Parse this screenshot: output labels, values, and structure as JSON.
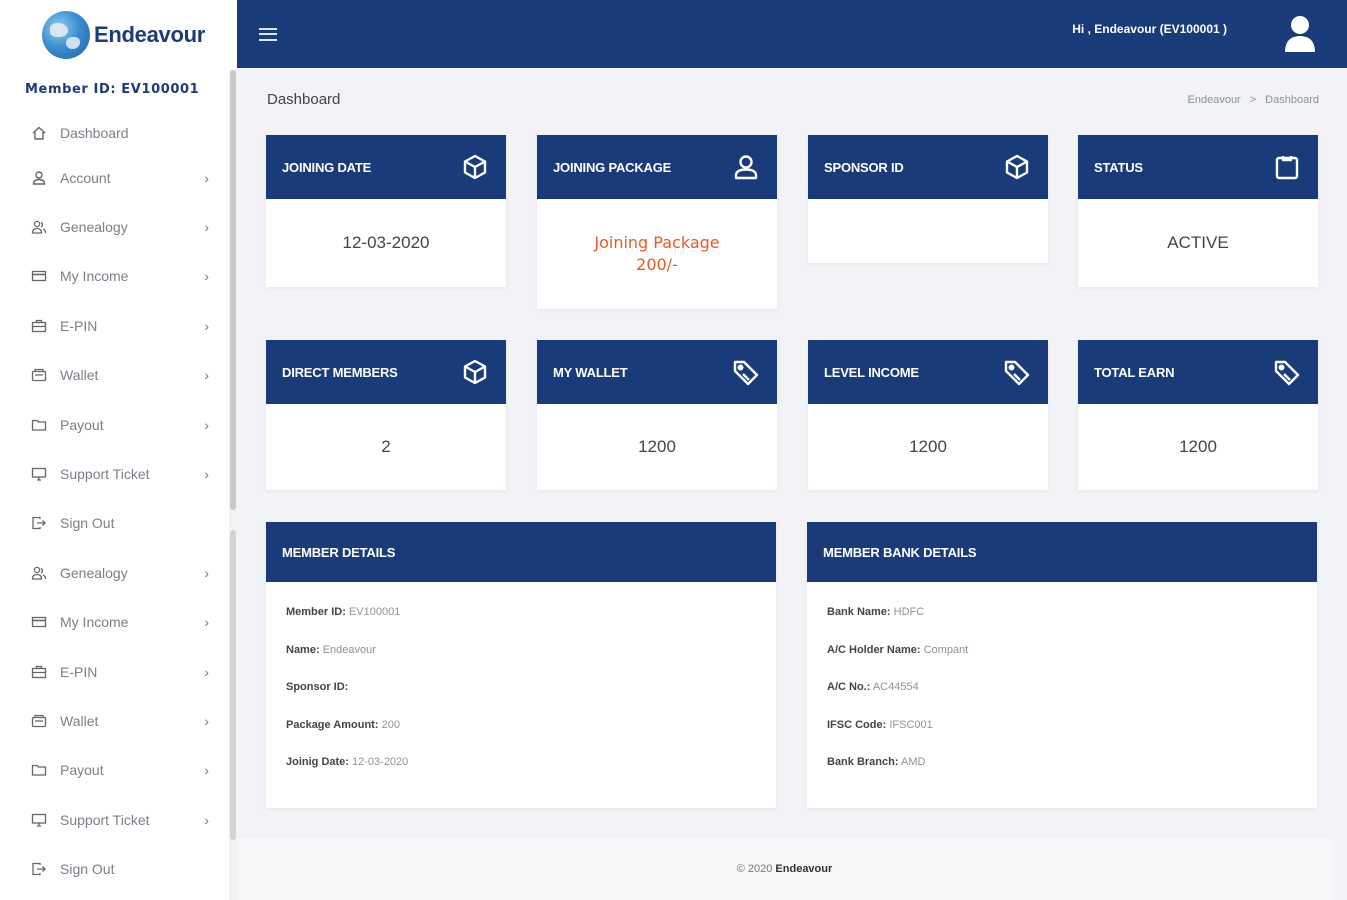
{
  "brand": {
    "name": "Endeavour"
  },
  "sidebar": {
    "member_id": "Member ID: EV100001",
    "items": [
      {
        "label": "Dashboard",
        "icon": "home-icon",
        "chevron": ""
      },
      {
        "label": "Account",
        "icon": "user-icon",
        "chevron": "›"
      },
      {
        "label": "Genealogy",
        "icon": "users-icon",
        "chevron": "›"
      },
      {
        "label": "My Income",
        "icon": "card-icon",
        "chevron": "›"
      },
      {
        "label": "E-PIN",
        "icon": "briefcase-icon",
        "chevron": "›"
      },
      {
        "label": "Wallet",
        "icon": "wallet-icon",
        "chevron": "›"
      },
      {
        "label": "Payout",
        "icon": "folder-icon",
        "chevron": "›"
      },
      {
        "label": "Support Ticket",
        "icon": "monitor-icon",
        "chevron": "›"
      },
      {
        "label": "Sign Out",
        "icon": "signout-icon",
        "chevron": ""
      },
      {
        "label": "Genealogy",
        "icon": "users-icon",
        "chevron": "›"
      },
      {
        "label": "My Income",
        "icon": "card-icon",
        "chevron": "›"
      },
      {
        "label": "E-PIN",
        "icon": "briefcase-icon",
        "chevron": "›"
      },
      {
        "label": "Wallet",
        "icon": "wallet-icon",
        "chevron": "›"
      },
      {
        "label": "Payout",
        "icon": "folder-icon",
        "chevron": "›"
      },
      {
        "label": "Support Ticket",
        "icon": "monitor-icon",
        "chevron": "›"
      },
      {
        "label": "Sign Out",
        "icon": "signout-icon",
        "chevron": ""
      }
    ]
  },
  "header": {
    "greeting": "Hi , Endeavour (EV100001 )"
  },
  "page": {
    "title": "Dashboard",
    "breadcrumb": {
      "home": "Endeavour",
      "separator": ">",
      "current": "Dashboard"
    }
  },
  "cards": {
    "joining_date": {
      "title": "JOINING DATE",
      "value": "12-03-2020",
      "icon": "cube-icon"
    },
    "joining_package": {
      "title": "JOINING PACKAGE",
      "value_line1": "Joining Package",
      "value_line2": "200/-",
      "icon": "user-icon"
    },
    "sponsor_id": {
      "title": "SPONSOR ID",
      "value": "",
      "icon": "cube-icon"
    },
    "status": {
      "title": "STATUS",
      "value": "ACTIVE",
      "icon": "clipboard-icon"
    },
    "direct_members": {
      "title": "DIRECT MEMBERS",
      "value": "2",
      "icon": "cube-icon"
    },
    "my_wallet": {
      "title": "MY WALLET",
      "value": "1200",
      "icon": "tag-icon"
    },
    "level_income": {
      "title": "LEVEL INCOME",
      "value": "1200",
      "icon": "tag-icon"
    },
    "total_earn": {
      "title": "TOTAL EARN",
      "value": "1200",
      "icon": "tag-icon"
    }
  },
  "member_details": {
    "title": "MEMBER DETAILS",
    "rows": [
      {
        "key": "Member ID:",
        "value": "EV100001"
      },
      {
        "key": "Name:",
        "value": "Endeavour"
      },
      {
        "key": "Sponsor ID:",
        "value": ""
      },
      {
        "key": "Package Amount:",
        "value": "200"
      },
      {
        "key": "Joinig Date:",
        "value": "12-03-2020"
      }
    ]
  },
  "bank_details": {
    "title": "MEMBER BANK DETAILS",
    "rows": [
      {
        "key": "Bank Name:",
        "value": "HDFC"
      },
      {
        "key": "A/C Holder Name:",
        "value": "Compant"
      },
      {
        "key": "A/C No.:",
        "value": "AC44554"
      },
      {
        "key": "IFSC Code:",
        "value": "IFSC001"
      },
      {
        "key": "Bank Branch:",
        "value": "AMD"
      }
    ]
  },
  "footer": {
    "prefix": "© 2020",
    "brand": "Endeavour"
  },
  "colors": {
    "primary": "#193b7a",
    "accent": "#ec5a24",
    "background": "#f2f3f7"
  }
}
